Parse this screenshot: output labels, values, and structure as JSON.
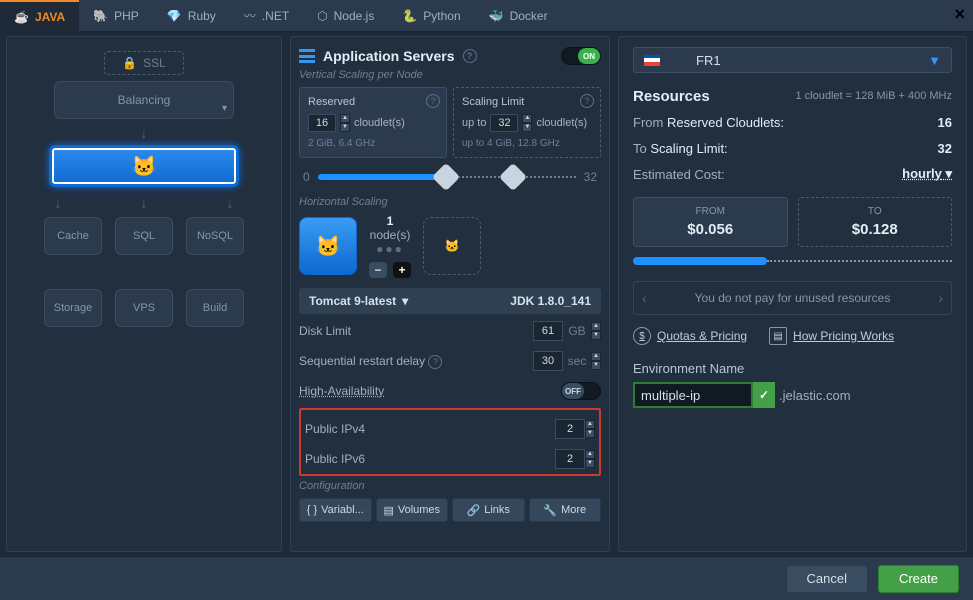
{
  "tabs": [
    {
      "icon": "☕",
      "label": "JAVA",
      "active": true
    },
    {
      "icon": "🐘",
      "label": "PHP"
    },
    {
      "icon": "💎",
      "label": "Ruby"
    },
    {
      "icon": "〰",
      "label": ".NET"
    },
    {
      "icon": "⬡",
      "label": "Node.js"
    },
    {
      "icon": "🐍",
      "label": "Python"
    },
    {
      "icon": "🐳",
      "label": "Docker"
    }
  ],
  "topology": {
    "ssl": "SSL",
    "balancing": "Balancing",
    "cache": "Cache",
    "sql": "SQL",
    "nosql": "NoSQL",
    "storage": "Storage",
    "vps": "VPS",
    "build": "Build"
  },
  "app": {
    "title": "Application Servers",
    "toggle": "ON",
    "vs_head": "Vertical Scaling per Node",
    "reserved_title": "Reserved",
    "reserved_value": "16",
    "cloudlets": "cloudlet(s)",
    "reserved_spec": "2 GiB, 6.4 GHz",
    "limit_title": "Scaling Limit",
    "limit_upto": "up to",
    "limit_value": "32",
    "limit_spec": "up to 4 GiB, 12.8 GHz",
    "slider_min": "0",
    "slider_max": "32",
    "hs_head": "Horizontal Scaling",
    "hs_count": "1",
    "hs_nodes": "node(s)",
    "server": "Tomcat 9-latest",
    "jdk": "JDK 1.8.0_141",
    "disk_label": "Disk Limit",
    "disk_val": "61",
    "disk_unit": "GB",
    "restart_label": "Sequential restart delay",
    "restart_val": "30",
    "restart_unit": "sec",
    "ha_label": "High-Availability",
    "ha_off": "OFF",
    "ipv4_label": "Public IPv4",
    "ipv4_val": "2",
    "ipv6_label": "Public IPv6",
    "ipv6_val": "2",
    "cfg_head": "Configuration",
    "cfg": {
      "vars": "Variabl...",
      "vols": "Volumes",
      "links": "Links",
      "more": "More"
    }
  },
  "region": {
    "name": "FR1"
  },
  "res": {
    "title": "Resources",
    "cloudlet_note": "1 cloudlet = 128 MiB + 400 MHz",
    "from_label": "From",
    "from_val_label": "Reserved Cloudlets:",
    "from_val": "16",
    "to_label": "To",
    "to_val_label": "Scaling Limit:",
    "to_val": "32",
    "cost_label": "Estimated Cost:",
    "cost_mode": "hourly",
    "from_box_label": "FROM",
    "from_price": "$0.056",
    "to_box_label": "TO",
    "to_price": "$0.128",
    "tip": "You do not pay for unused resources",
    "quotas": "Quotas & Pricing",
    "howpricing": "How Pricing Works",
    "env_label": "Environment Name",
    "env_name": "multiple-ip",
    "env_suffix": ".jelastic.com"
  },
  "footer": {
    "cancel": "Cancel",
    "create": "Create"
  }
}
